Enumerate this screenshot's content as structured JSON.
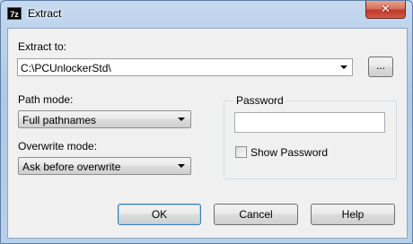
{
  "window": {
    "icon_text": "7z",
    "title": "Extract",
    "close_glyph": "✕"
  },
  "extract_to": {
    "label": "Extract to:",
    "value": "C:\\PCUnlockerStd\\",
    "browse_label": "..."
  },
  "path_mode": {
    "label": "Path mode:",
    "value": "Full pathnames"
  },
  "overwrite_mode": {
    "label": "Overwrite mode:",
    "value": "Ask before overwrite"
  },
  "password": {
    "group_label": "Password",
    "value": "",
    "show_label": "Show Password",
    "show_checked": false
  },
  "buttons": {
    "ok": "OK",
    "cancel": "Cancel",
    "help": "Help"
  }
}
